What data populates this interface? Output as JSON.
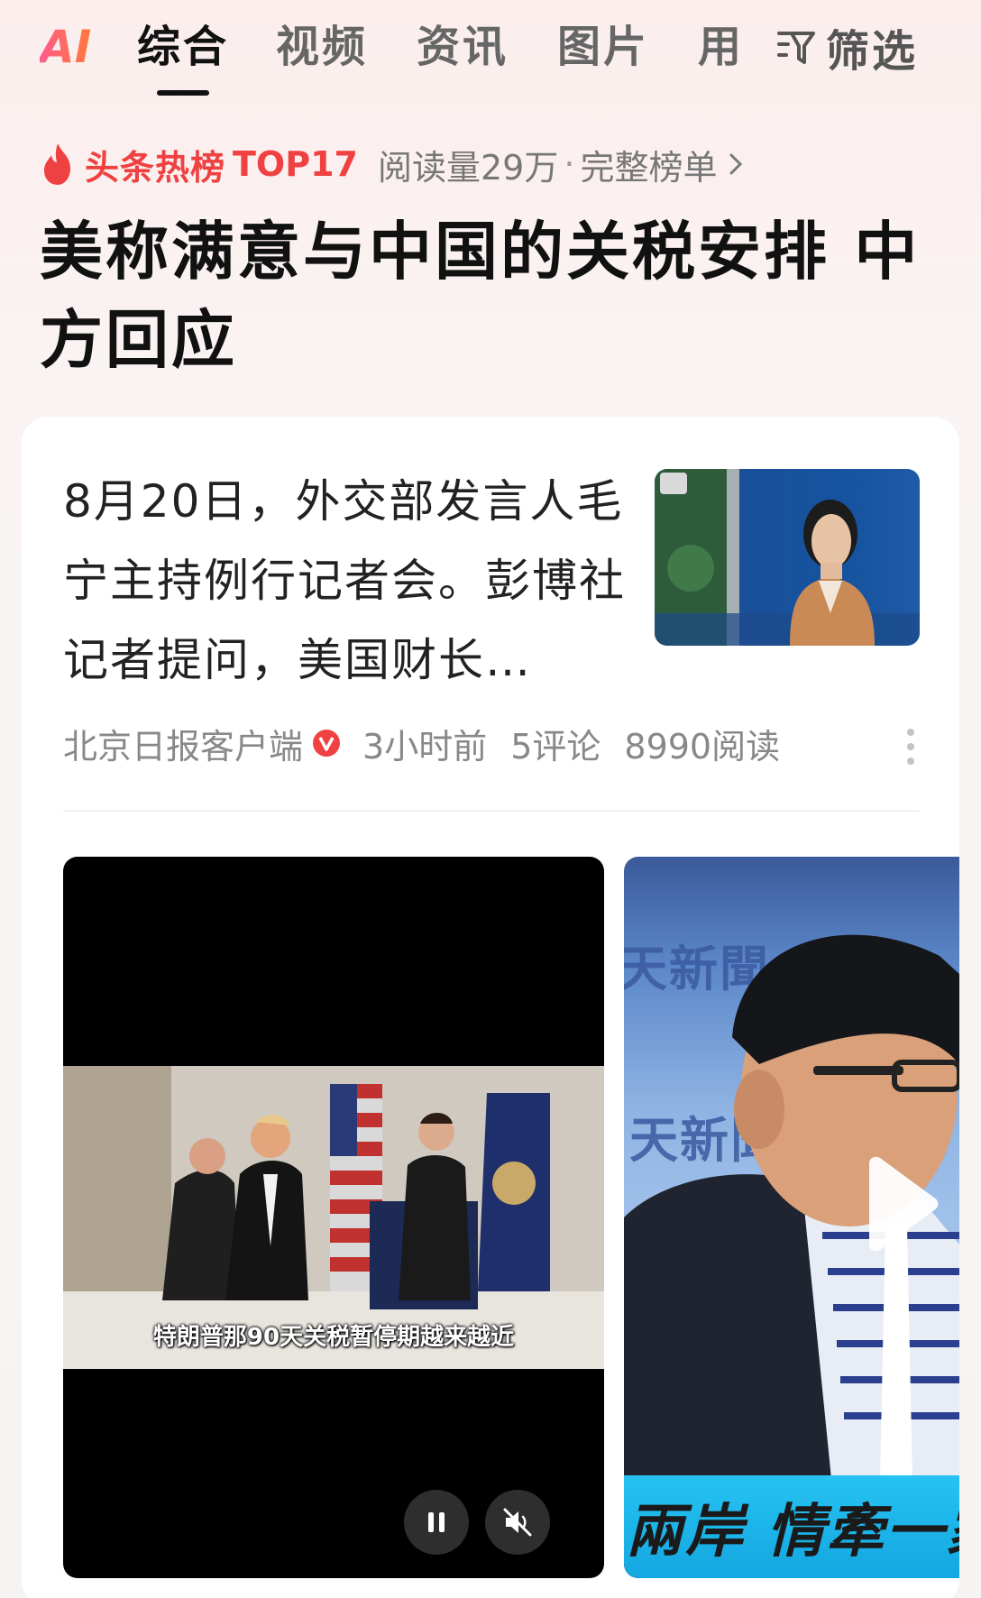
{
  "tabs": {
    "ai": "AI",
    "items": [
      "综合",
      "视频",
      "资讯",
      "图片",
      "用"
    ],
    "filter_label": "筛选"
  },
  "hot": {
    "label": "头条热榜",
    "rank": "TOP17",
    "reads": "阅读量29万",
    "separator": "·",
    "full_list": "完整榜单"
  },
  "headline": "美称满意与中国的关税安排 中方回应",
  "article": {
    "summary": "8月20日，外交部发言人毛宁主持例行记者会。彭博社记者提问，美国财长…",
    "source": "北京日报客户端",
    "time": "3小时前",
    "comments": "5评论",
    "reads": "8990阅读"
  },
  "videos": {
    "video1_caption": "特朗普那90天关税暂停期越来越近",
    "video2_overlay_1": "天新聞",
    "video2_overlay_2": "天新聞",
    "video2_ticker": "兩岸 情牽一家"
  },
  "colors": {
    "accent_red": "#f04142",
    "ai_gradient_start": "#ff5b8a",
    "ai_gradient_end": "#ff7a3c",
    "ticker_blue": "#26c3f2"
  },
  "icons": [
    "filter-icon",
    "flame-icon",
    "chevron-right-icon",
    "verified-icon",
    "more-icon",
    "pause-icon",
    "mute-icon",
    "play-icon"
  ]
}
